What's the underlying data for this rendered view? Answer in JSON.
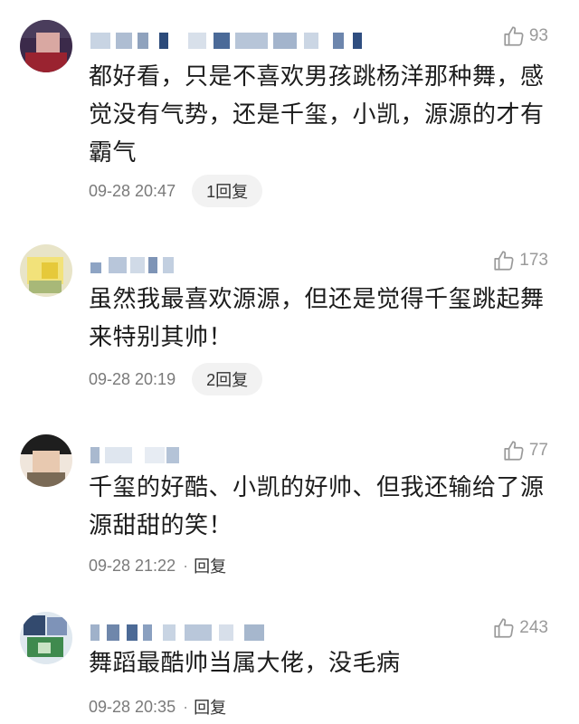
{
  "comments": [
    {
      "likes": "93",
      "text": "都好看，只是不喜欢男孩跳杨洋那种舞，感觉没有气势，还是千玺，小凯，源源的才有霸气",
      "time": "09-28 20:47",
      "reply": "1回复"
    },
    {
      "likes": "173",
      "text": "虽然我最喜欢源源，但还是觉得千玺跳起舞来特别其帅！",
      "time": "09-28 20:19",
      "reply": "2回复"
    },
    {
      "likes": "77",
      "text": "千玺的好酷、小凯的好帅、但我还输给了源源甜甜的笑！",
      "time": "09-28 21:22",
      "reply": "回复"
    },
    {
      "likes": "243",
      "text": "舞蹈最酷帅当属大佬，没毛病",
      "time": "09-28 20:35",
      "reply": "回复"
    }
  ],
  "icons": {
    "like": "thumbs-up-icon"
  }
}
